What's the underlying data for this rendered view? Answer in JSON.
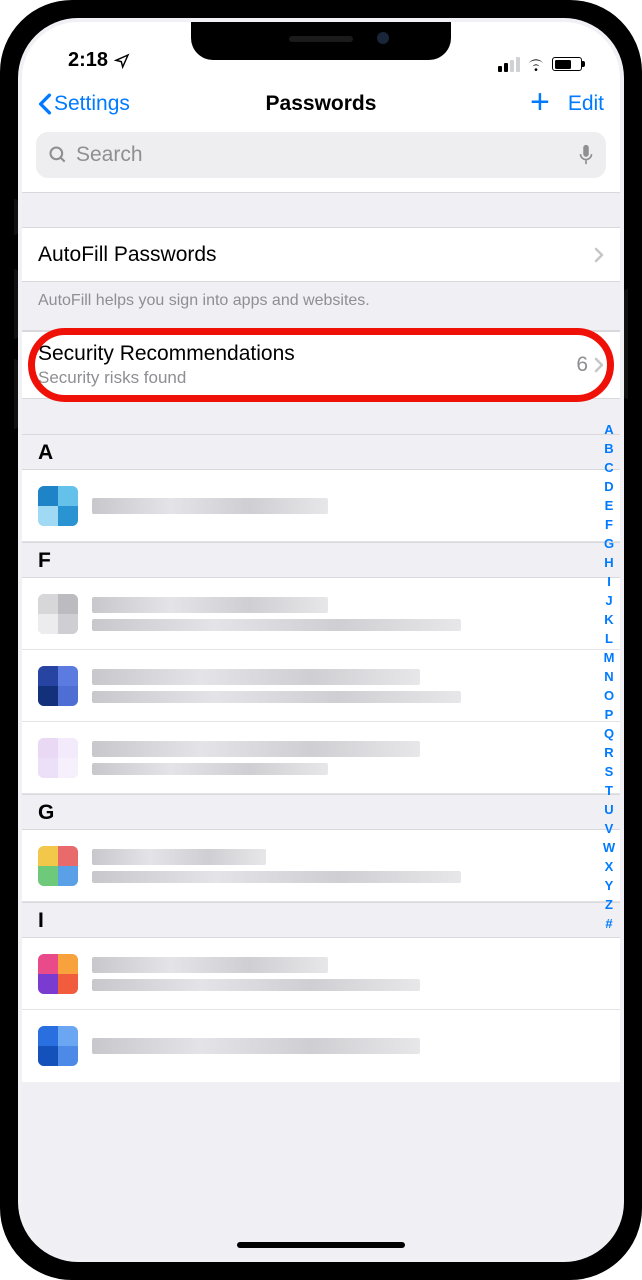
{
  "status": {
    "time": "2:18"
  },
  "nav": {
    "back": "Settings",
    "title": "Passwords",
    "edit": "Edit"
  },
  "search": {
    "placeholder": "Search"
  },
  "autofill": {
    "label": "AutoFill Passwords",
    "note": "AutoFill helps you sign into apps and websites."
  },
  "security": {
    "title": "Security Recommendations",
    "subtitle": "Security risks found",
    "count": "6"
  },
  "sections": {
    "h0": "A",
    "h1": "F",
    "h2": "G",
    "h3": "I"
  },
  "index": [
    "A",
    "B",
    "C",
    "D",
    "E",
    "F",
    "G",
    "H",
    "I",
    "J",
    "K",
    "L",
    "M",
    "N",
    "O",
    "P",
    "Q",
    "R",
    "S",
    "T",
    "U",
    "V",
    "W",
    "X",
    "Y",
    "Z",
    "#"
  ]
}
